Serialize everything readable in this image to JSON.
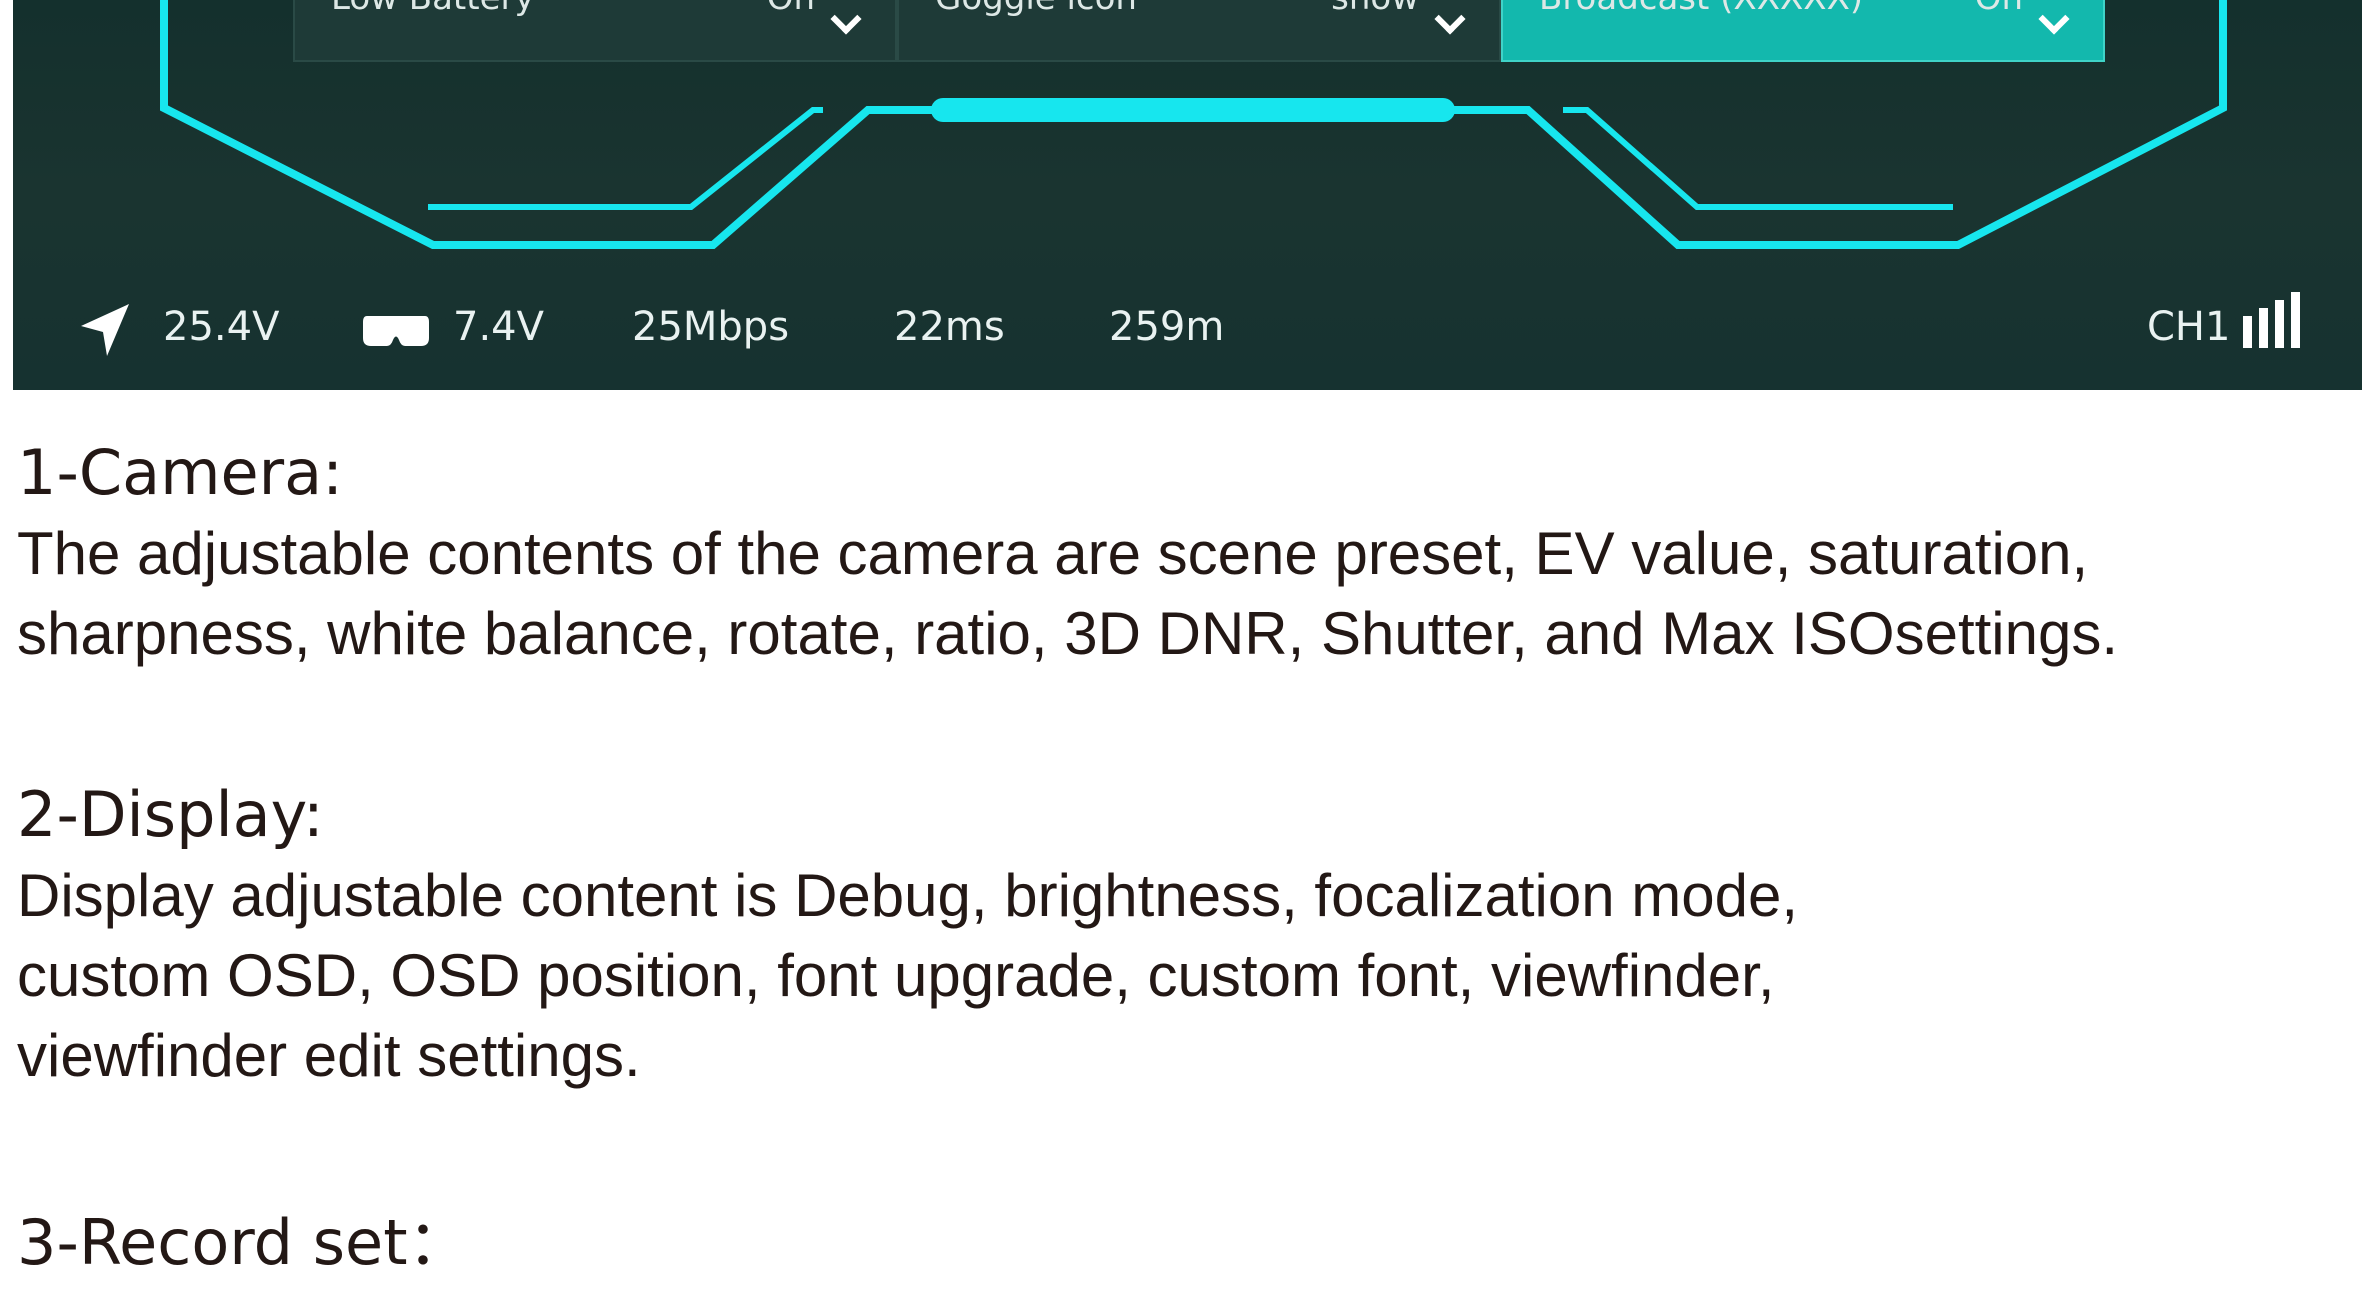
{
  "menu": [
    {
      "label": "Low Battery",
      "value": "On"
    },
    {
      "label": "Goggle icon",
      "value": "show"
    },
    {
      "label": "Broadcast (XXXXX)",
      "value": "On"
    }
  ],
  "status": {
    "drone_voltage": "25.4V",
    "goggle_voltage": "7.4V",
    "bitrate": "25Mbps",
    "latency": "22ms",
    "distance": "259m",
    "channel": "CH1"
  },
  "colors": {
    "hud_accent": "#17e6ee",
    "menu_active": "#13b8ad",
    "screen_bg": "#173230"
  },
  "sections": [
    {
      "heading": "1-Camera:",
      "lines": [
        "The adjustable contents of the camera are scene preset, EV value, saturation,",
        "sharpness, white balance, rotate, ratio, 3D DNR, Shutter, and Max ISOsettings."
      ]
    },
    {
      "heading": "2-Display:",
      "lines": [
        "Display adjustable content is Debug, brightness, focalization mode,",
        "custom OSD, OSD position, font upgrade, custom font, viewfinder,",
        "viewfinder edit settings."
      ]
    },
    {
      "heading": "3-Record set：",
      "lines": []
    }
  ]
}
